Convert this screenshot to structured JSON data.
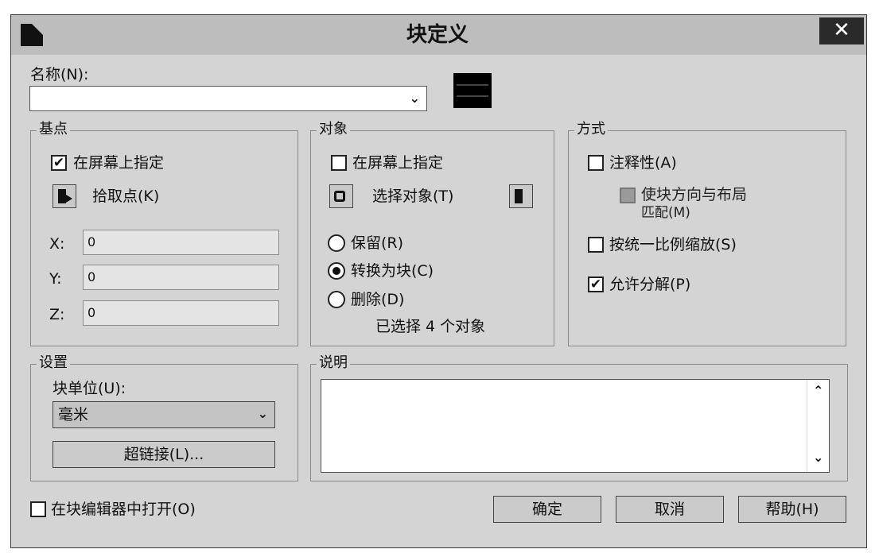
{
  "window": {
    "title": "块定义",
    "close_glyph": "✕"
  },
  "name": {
    "label": "名称(N):",
    "value": "",
    "dropdown_glyph": "⌄"
  },
  "base_point": {
    "legend": "基点",
    "specify_on_screen": {
      "label": "在屏幕上指定",
      "checked": true,
      "glyph": "✔"
    },
    "pick_point_label": "拾取点(K)",
    "x": {
      "label": "X:",
      "value": "0"
    },
    "y": {
      "label": "Y:",
      "value": "0"
    },
    "z": {
      "label": "Z:",
      "value": "0"
    }
  },
  "objects": {
    "legend": "对象",
    "specify_on_screen": {
      "label": "在屏幕上指定",
      "checked": false
    },
    "select_objects_label": "选择对象(T)",
    "retain_label": "保留(R)",
    "convert_label": "转换为块(C)",
    "delete_label": "删除(D)",
    "selected_count_text": "已选择 4 个对象",
    "selected_option": "convert"
  },
  "behavior": {
    "legend": "方式",
    "annotative": {
      "label": "注释性(A)",
      "checked": false
    },
    "match_orientation_line1": "使块方向与布局",
    "match_orientation_line2": "匹配(M)",
    "scale_uniformly": {
      "label": "按统一比例缩放(S)",
      "checked": false
    },
    "allow_exploding": {
      "label": "允许分解(P)",
      "checked": true,
      "glyph": "✔"
    }
  },
  "settings": {
    "legend": "设置",
    "block_unit_label": "块单位(U):",
    "block_unit_value": "毫米",
    "hyperlink_label": "超链接(L)..."
  },
  "description": {
    "legend": "说明",
    "value": "",
    "scroll_up": "⌃",
    "scroll_down": "⌄"
  },
  "open_in_editor": {
    "label": "在块编辑器中打开(O)",
    "checked": false
  },
  "buttons": {
    "ok": "确定",
    "cancel": "取消",
    "help": "帮助(H)"
  }
}
